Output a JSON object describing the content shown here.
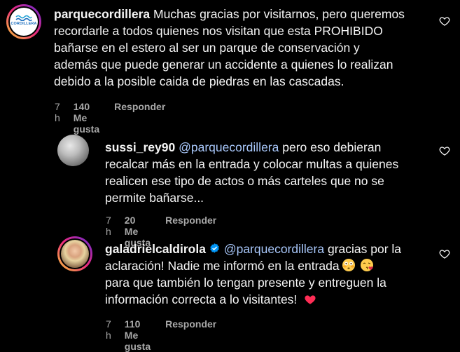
{
  "comments": [
    {
      "username": "parquecordillera",
      "avatar_logo_text": "CORDILLERA",
      "text": "Muchas gracias por visitarnos, pero queremos recordarle a todos quienes nos visitan que esta PROHIBIDO bañarse en el estero al ser un parque de conservación y además que puede generar un accidente a quienes lo realizan debido a la posible caida de piedras en las cascadas.",
      "lines": [
        "Muchas gracias por visitarnos, pero queremos",
        "recordarle a todos quienes nos visitan que esta PROHIBIDO",
        "bañarse en el estero al ser un parque de conservación y",
        "además que puede generar un accidente a quienes lo realizan",
        "debido a la posible caida de piedras en las cascadas."
      ],
      "time": "7 h",
      "likes": "140 Me gusta",
      "reply_label": "Responder"
    },
    {
      "username": "sussi_rey90",
      "mention": "@parquecordillera",
      "lines": [
        "pero eso debieran",
        "recalcar más en la entrada y colocar multas a quienes",
        "realicen ese tipo de actos o más carteles que no se",
        "permite bañarse..."
      ],
      "time": "7 h",
      "likes": "20 Me gusta",
      "reply_label": "Responder"
    },
    {
      "username": "galadrielcaldirola",
      "verified": true,
      "mention": "@parquecordillera",
      "lines": [
        "gracias por la",
        "aclaración! Nadie me informó en la entrada",
        "para que también lo tengan presente y entreguen la",
        "información correcta a lo visitantes!"
      ],
      "emojis": [
        "flushed-face",
        "face-blowing-kiss",
        "red-heart"
      ],
      "time": "7 h",
      "likes": "110 Me gusta",
      "reply_label": "Responder"
    }
  ],
  "colors": {
    "background": "#000000",
    "text": "#f5f5f5",
    "meta": "#a8a8a8",
    "mention": "#a8c7fa",
    "verified": "#0095f6",
    "heart_emoji": "#ff2d55"
  }
}
